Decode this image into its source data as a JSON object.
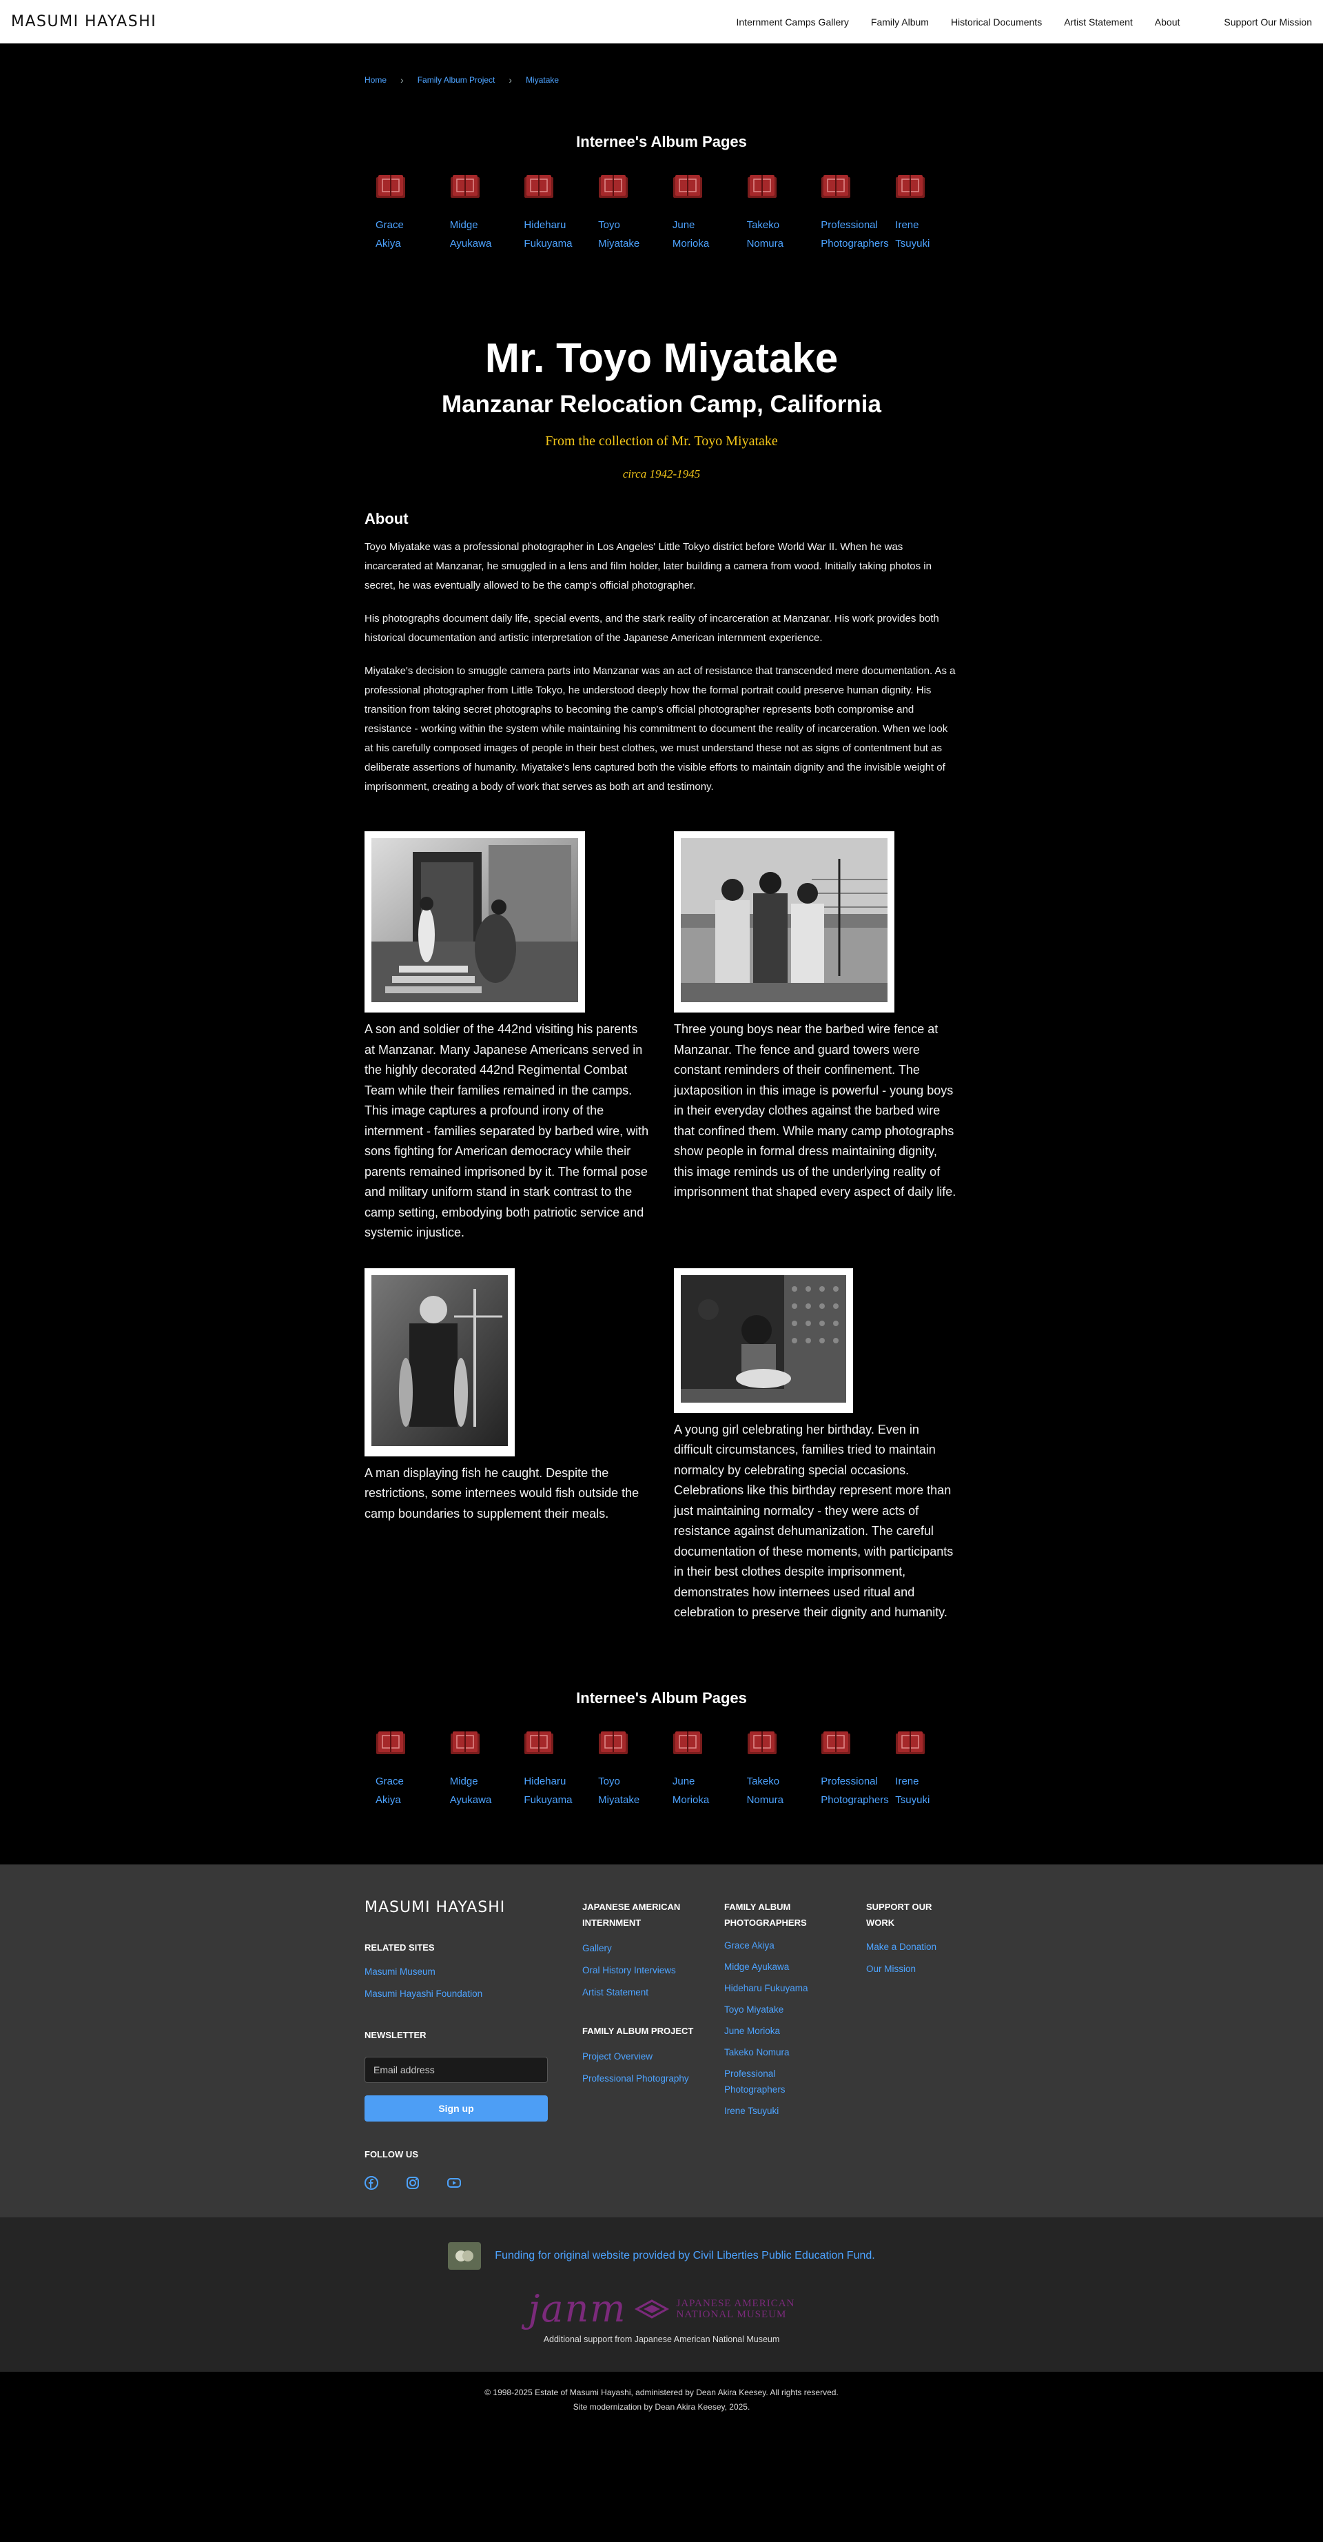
{
  "header": {
    "brand": "MASUMI HAYASHI",
    "nav": [
      "Internment Camps Gallery",
      "Family Album",
      "Historical Documents",
      "Artist Statement",
      "About"
    ],
    "mission": "Support Our Mission"
  },
  "breadcrumb": [
    "Home",
    "Family Album Project",
    "Miyatake"
  ],
  "album": {
    "title": "Internee's Album Pages",
    "items": [
      {
        "first": "Grace",
        "last": "Akiya"
      },
      {
        "first": "Midge",
        "last": "Ayukawa"
      },
      {
        "first": "Hideharu",
        "last": "Fukuyama"
      },
      {
        "first": "Toyo",
        "last": "Miyatake"
      },
      {
        "first": "June",
        "last": "Morioka"
      },
      {
        "first": "Takeko",
        "last": "Nomura"
      },
      {
        "first": "Professional",
        "last": "Photographers"
      },
      {
        "first": "Irene",
        "last": "Tsuyuki"
      }
    ]
  },
  "hero": {
    "name": "Mr. Toyo Miyatake",
    "camp": "Manzanar Relocation Camp, California",
    "from": "From the collection of Mr. Toyo Miyatake",
    "circa": "circa 1942-1945"
  },
  "about": {
    "heading": "About",
    "paragraphs": [
      "Toyo Miyatake was a professional photographer in Los Angeles' Little Tokyo district before World War II. When he was incarcerated at Manzanar, he smuggled in a lens and film holder, later building a camera from wood. Initially taking photos in secret, he was eventually allowed to be the camp's official photographer.",
      "His photographs document daily life, special events, and the stark reality of incarceration at Manzanar. His work provides both historical documentation and artistic interpretation of the Japanese American internment experience.",
      "Miyatake's decision to smuggle camera parts into Manzanar was an act of resistance that transcended mere documentation. As a professional photographer from Little Tokyo, he understood deeply how the formal portrait could preserve human dignity. His transition from taking secret photographs to becoming the camp's official photographer represents both compromise and resistance - working within the system while maintaining his commitment to document the reality of incarceration. When we look at his carefully composed images of people in their best clothes, we must understand these not as signs of contentment but as deliberate assertions of humanity. Miyatake's lens captured both the visible efforts to maintain dignity and the invisible weight of imprisonment, creating a body of work that serves as both art and testimony."
    ]
  },
  "photos": [
    {
      "caption": "A son and soldier of the 442nd visiting his parents at Manzanar. Many Japanese Americans served in the highly decorated 442nd Regimental Combat Team while their families remained in the camps. This image captures a profound irony of the internment - families separated by barbed wire, with sons fighting for American democracy while their parents remained imprisoned by it. The formal pose and military uniform stand in stark contrast to the camp setting, embodying both patriotic service and systemic injustice."
    },
    {
      "caption": "Three young boys near the barbed wire fence at Manzanar. The fence and guard towers were constant reminders of their confinement. The juxtaposition in this image is powerful - young boys in their everyday clothes against the barbed wire that confined them. While many camp photographs show people in formal dress maintaining dignity, this image reminds us of the underlying reality of imprisonment that shaped every aspect of daily life."
    },
    {
      "caption": "A man displaying fish he caught. Despite the restrictions, some internees would fish outside the camp boundaries to supplement their meals."
    },
    {
      "caption": "A young girl celebrating her birthday. Even in difficult circumstances, families tried to maintain normalcy by celebrating special occasions. Celebrations like this birthday represent more than just maintaining normalcy - they were acts of resistance against dehumanization. The careful documentation of these moments, with participants in their best clothes despite imprisonment, demonstrates how internees used ritual and celebration to preserve their dignity and humanity."
    }
  ],
  "footer": {
    "brand": "MASUMI HAYASHI",
    "related_heading": "RELATED SITES",
    "related": [
      "Masumi Museum",
      "Masumi Hayashi Foundation"
    ],
    "newsletter_heading": "NEWSLETTER",
    "email_placeholder": "Email address",
    "signup": "Sign up",
    "follow_heading": "FOLLOW US",
    "jai_heading": "JAPANESE AMERICAN INTERNMENT",
    "jai_links": [
      "Gallery",
      "Oral History Interviews",
      "Artist Statement"
    ],
    "fap_heading": "FAMILY ALBUM PROJECT",
    "fap_links": [
      "Project Overview",
      "Professional Photography"
    ],
    "fapp_heading": "FAMILY ALBUM PHOTOGRAPHERS",
    "fapp_links": [
      "Grace Akiya",
      "Midge Ayukawa",
      "Hideharu Fukuyama",
      "Toyo Miyatake",
      "June Morioka",
      "Takeko Nomura",
      "Professional Photographers",
      "Irene Tsuyuki"
    ],
    "support_heading": "SUPPORT OUR WORK",
    "support_links": [
      "Make a Donation",
      "Our Mission"
    ]
  },
  "funding": {
    "text": "Funding for original website provided by Civil Liberties Public Education Fund.",
    "janm_word": "janm",
    "janm_line1": "JAPANESE AMERICAN",
    "janm_line2": "NATIONAL MUSEUM",
    "janm_sub": "Additional support from Japanese American National Museum"
  },
  "copyright": {
    "line1": "© 1998-2025 Estate of Masumi Hayashi, administered by Dean Akira Keesey. All rights reserved.",
    "line2": "Site modernization by Dean Akira Keesey, 2025."
  }
}
